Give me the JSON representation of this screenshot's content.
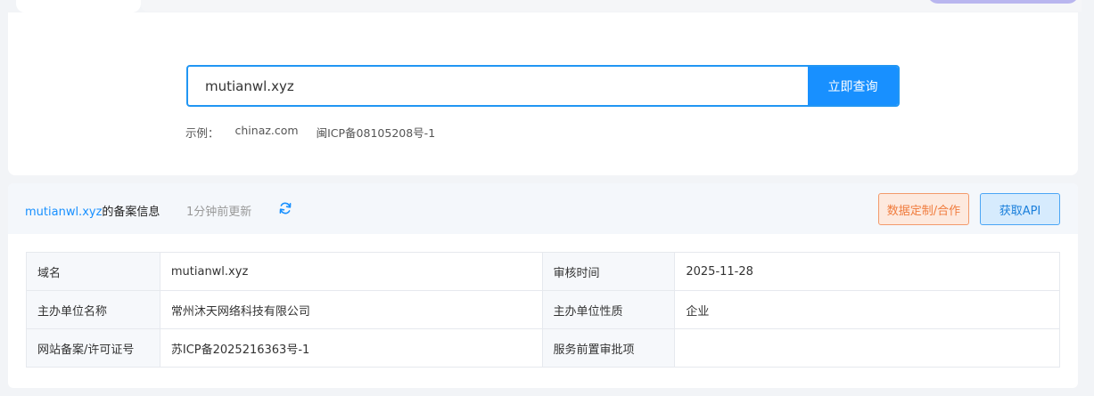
{
  "search": {
    "value": "mutianwl.xyz",
    "button_label": "立即查询",
    "examples_label": "示例：",
    "examples": [
      "chinaz.com",
      "闽ICP备08105208号-1"
    ]
  },
  "result": {
    "domain": "mutianwl.xyz",
    "title_suffix": "的备案信息",
    "updated": "1分钟前更新",
    "refresh_icon": "refresh-icon",
    "custom_button": "数据定制/合作",
    "api_button": "获取API",
    "rows": [
      {
        "k1": "域名",
        "v1": "mutianwl.xyz",
        "k2": "审核时间",
        "v2": "2025-11-28"
      },
      {
        "k1": "主办单位名称",
        "v1": "常州沐天网络科技有限公司",
        "k2": "主办单位性质",
        "v2": "企业"
      },
      {
        "k1": "网站备案/许可证号",
        "v1": "苏ICP备2025216363号-1",
        "k2": "服务前置审批项",
        "v2": ""
      }
    ]
  },
  "colors": {
    "accent": "#1890ff",
    "orange": "#f07c3d"
  }
}
